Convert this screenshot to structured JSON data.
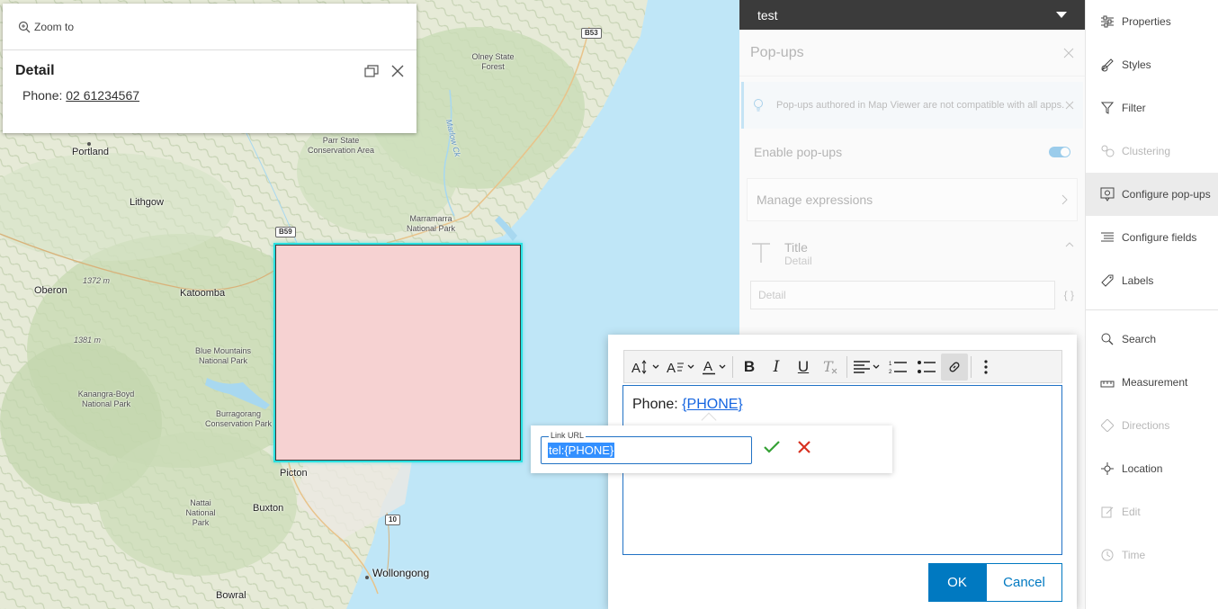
{
  "map": {
    "zoom_to_label": "Zoom to",
    "popup": {
      "title": "Detail",
      "field_label": "Phone:",
      "field_value": "02 61234567"
    },
    "places": {
      "olney": "Olney State Forest",
      "portland": "Portland",
      "parr": "Parr State Conservation Area",
      "marlow": "Marlow Ck",
      "lithgow": "Lithgow",
      "marramarra": "Marramarra National Park",
      "oberon": "Oberon",
      "katoomba": "Katoomba",
      "elev1": "1372 m",
      "elev2": "1381 m",
      "blue_mountains": "Blue Mountains National Park",
      "kanangra": "Kanangra-Boyd National Park",
      "burragorang": "Burragorang Conservation Park",
      "picton": "Picton",
      "nattai": "Nattai National Park",
      "buxton": "Buxton",
      "wollongong": "Wollongong",
      "bowral": "Bowral"
    },
    "shields": {
      "b53": "B53",
      "b59": "B59",
      "r10": "10"
    }
  },
  "panel": {
    "layer_name": "test",
    "section_title": "Pop-ups",
    "notice": "Pop-ups authored in Map Viewer are not compatible with all apps.",
    "enable_label": "Enable pop-ups",
    "manage_label": "Manage expressions",
    "title_label": "Title",
    "title_sub": "Detail",
    "title_input_value": "Detail",
    "braces": "{ }"
  },
  "menu": {
    "items": [
      {
        "label": "Properties",
        "icon": "sliders-icon"
      },
      {
        "label": "Styles",
        "icon": "styles-icon"
      },
      {
        "label": "Filter",
        "icon": "filter-icon"
      },
      {
        "label": "Clustering",
        "icon": "clustering-icon"
      },
      {
        "label": "Configure pop-ups",
        "icon": "popup-config-icon"
      },
      {
        "label": "Configure fields",
        "icon": "fields-icon"
      },
      {
        "label": "Labels",
        "icon": "label-icon"
      },
      {
        "label": "Search",
        "icon": "search-icon"
      },
      {
        "label": "Measurement",
        "icon": "ruler-icon"
      },
      {
        "label": "Directions",
        "icon": "directions-icon"
      },
      {
        "label": "Location",
        "icon": "crosshair-icon"
      },
      {
        "label": "Edit",
        "icon": "edit-icon"
      },
      {
        "label": "Time",
        "icon": "clock-icon"
      }
    ]
  },
  "editor": {
    "text_prefix": "Phone:",
    "link_text": "{PHONE}",
    "link_url_label": "Link URL",
    "link_url_value": "tel:{PHONE}",
    "ok_label": "OK",
    "cancel_label": "Cancel"
  },
  "colors": {
    "accent": "#0079c1",
    "polygon_fill": "#f6d2d2",
    "polygon_highlight": "#29e0e0",
    "confirm": "#35a135",
    "cancel": "#d83020"
  }
}
